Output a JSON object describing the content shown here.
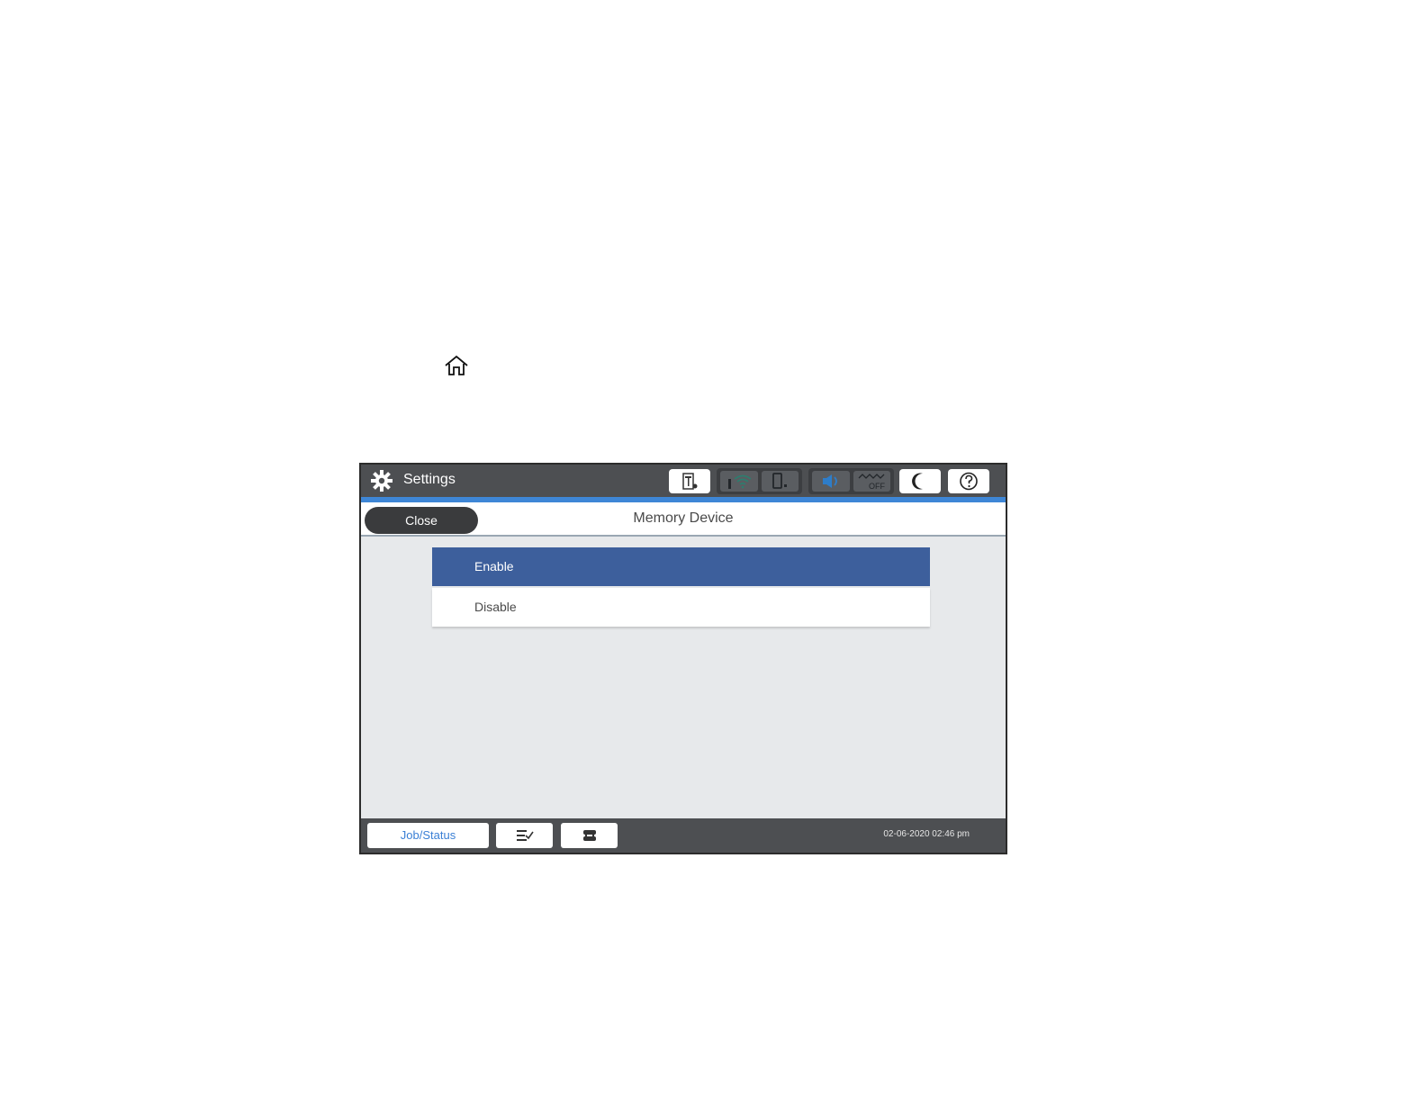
{
  "topbar": {
    "title": "Settings"
  },
  "header": {
    "close_label": "Close",
    "title": "Memory Device"
  },
  "options": [
    {
      "label": "Enable",
      "selected": true
    },
    {
      "label": "Disable",
      "selected": false
    }
  ],
  "bottombar": {
    "job_status_label": "Job/Status",
    "datetime": "02-06-2020 02:46 pm"
  },
  "status_icons": {
    "sleep_off_label": "OFF"
  },
  "colors": {
    "accent": "#3e86d6",
    "selected_row": "#3d5f9c",
    "bar": "#4d4f52"
  }
}
